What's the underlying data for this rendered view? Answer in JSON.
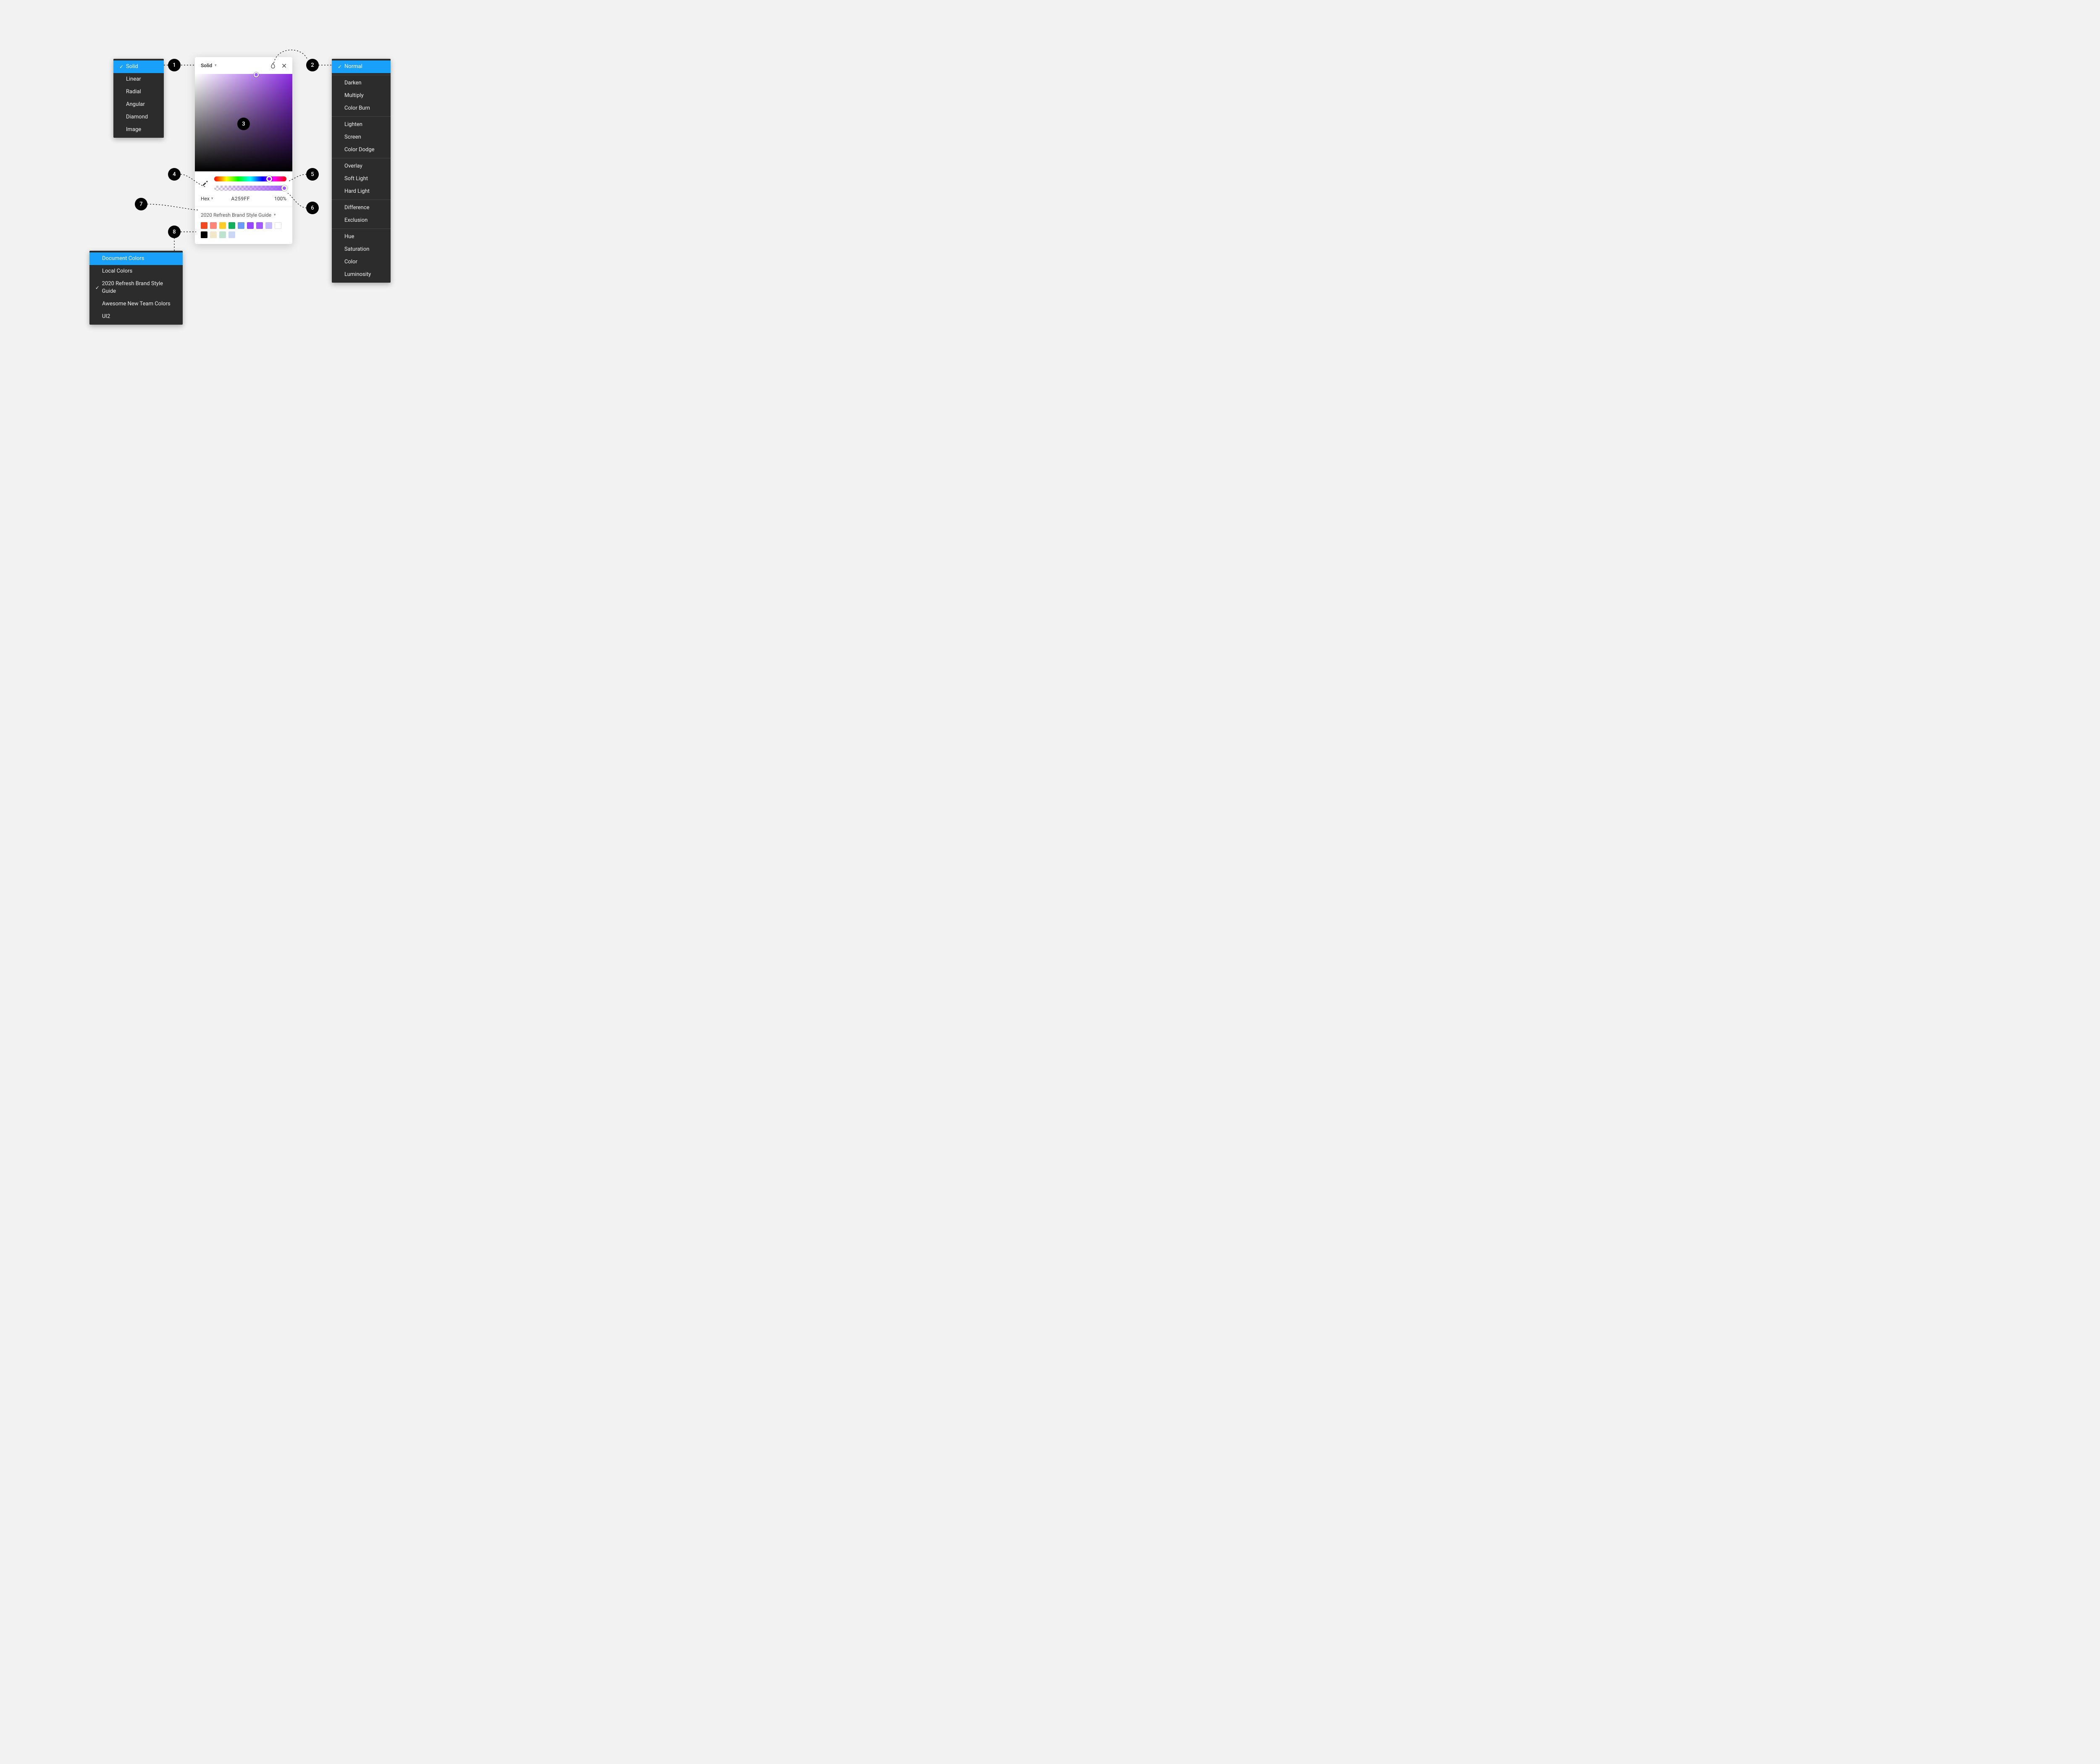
{
  "fillTypeMenu": {
    "items": [
      "Solid",
      "Linear",
      "Radial",
      "Angular",
      "Diamond",
      "Image"
    ],
    "selected": "Solid"
  },
  "blendMenu": {
    "groups": [
      [
        "Normal"
      ],
      [
        "Darken",
        "Multiply",
        "Color Burn"
      ],
      [
        "Lighten",
        "Screen",
        "Color Dodge"
      ],
      [
        "Overlay",
        "Soft Light",
        "Hard Light"
      ],
      [
        "Difference",
        "Exclusion"
      ],
      [
        "Hue",
        "Saturation",
        "Color",
        "Luminosity"
      ]
    ],
    "selected": "Normal"
  },
  "libraryMenu": {
    "items": [
      "Document Colors",
      "Local Colors",
      "2020 Refresh Brand Style Guide",
      "Awesome New Team Colors",
      "UI2"
    ],
    "highlighted": "Document Colors",
    "checked": "2020 Refresh Brand Style Guide"
  },
  "picker": {
    "paintTypeLabel": "Solid",
    "colorModeLabel": "Hex",
    "hexValue": "A259FF",
    "opacityValue": "100%",
    "librarySelectedLabel": "2020 Refresh Brand Style Guide",
    "swatches": [
      "#F24822",
      "#FF8577",
      "#FFCD29",
      "#14AE5C",
      "#699BF7",
      "#9747FF",
      "#A259FF",
      "#C7B9FF",
      "#FFFFFF",
      "#000000",
      "#F3E7C9",
      "#BDE3CE",
      "#CBD8F5"
    ]
  },
  "annotations": {
    "b1": "1",
    "b2": "2",
    "b3": "3",
    "b4": "4",
    "b5": "5",
    "b6": "6",
    "b7": "7",
    "b8": "8"
  }
}
